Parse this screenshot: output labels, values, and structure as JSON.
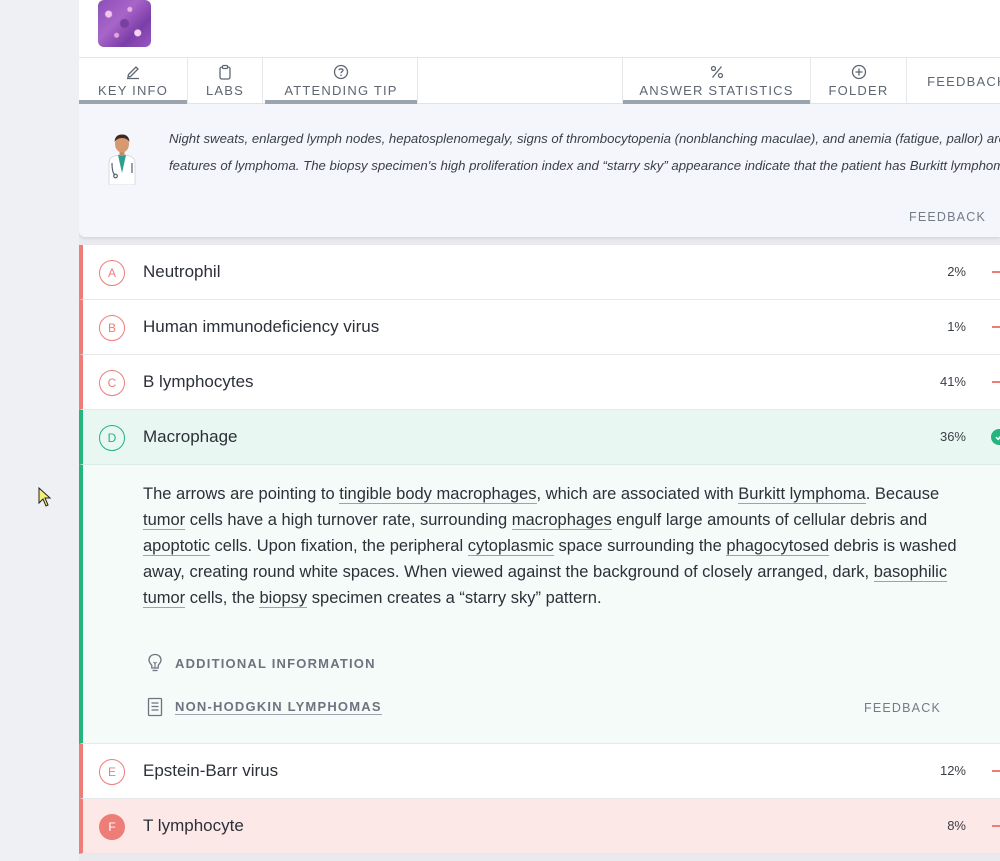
{
  "tabs": [
    {
      "label": "KEY INFO",
      "icon": "pencil-icon"
    },
    {
      "label": "LABS",
      "icon": "clipboard-icon"
    },
    {
      "label": "ATTENDING TIP",
      "icon": "question-circle-icon"
    },
    {
      "label": "ANSWER STATISTICS",
      "icon": "percent-icon"
    },
    {
      "label": "FOLDER",
      "icon": "plus-circle-icon"
    },
    {
      "label": "FEEDBACK",
      "icon": ""
    }
  ],
  "tip": {
    "text": "Night sweats, enlarged lymph nodes, hepatosplenomegaly, signs of thrombocytopenia (nonblanching maculae), and anemia (fatigue, pallor) are features of lymphoma. The biopsy specimen's high proliferation index and “starry sky” appearance indicate that the patient has Burkitt lymphoma.",
    "feedback_label": "FEEDBACK"
  },
  "answers": [
    {
      "letter": "A",
      "text": "Neutrophil",
      "pct": "2%"
    },
    {
      "letter": "B",
      "text": "Human immunodeficiency virus",
      "pct": "1%"
    },
    {
      "letter": "C",
      "text": "B lymphocytes",
      "pct": "41%"
    },
    {
      "letter": "D",
      "text": "Macrophage",
      "pct": "36%"
    },
    {
      "letter": "E",
      "text": "Epstein-Barr virus",
      "pct": "12%"
    },
    {
      "letter": "F",
      "text": "T lymphocyte",
      "pct": "8%"
    }
  ],
  "explanation": {
    "p1": "The arrows are pointing to ",
    "l1": "tingible body macrophages",
    "p2": ", which are associated with ",
    "l2": "Burkitt lymphoma",
    "p3": ". Because ",
    "l3": "tumor",
    "p4": " cells have a high turnover rate, surrounding ",
    "l4": "macrophages",
    "p5": " engulf large amounts of cellular debris and ",
    "l5": "apoptotic",
    "p6": " cells. Upon fixation, the peripheral ",
    "l6": "cytoplasmic",
    "p7": " space surrounding the ",
    "l7": "phagocytosed",
    "p8": " debris is washed away, creating round white spaces. When viewed against the background of closely arranged, dark, ",
    "l8": "basophilic",
    "p9": " ",
    "l9": "tumor",
    "p10": " cells, the ",
    "l10": "biopsy",
    "p11": " specimen creates a “starry sky” pattern.",
    "additional_info_label": "ADDITIONAL INFORMATION",
    "article_label": "NON-HODGKIN LYMPHOMAS",
    "feedback_label": "FEEDBACK"
  },
  "colors": {
    "incorrect": "#ee7d78",
    "correct": "#22b57e",
    "selected_bg": "#fde8e8"
  }
}
